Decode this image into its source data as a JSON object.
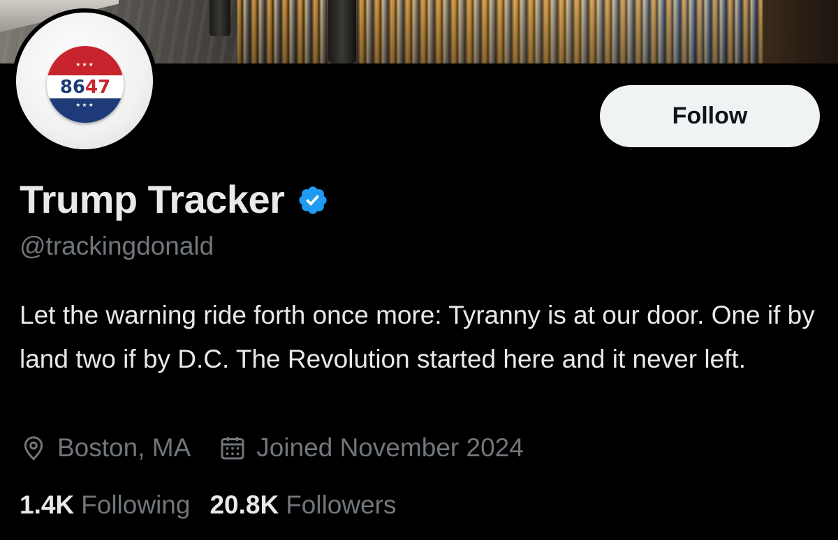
{
  "profile": {
    "display_name": "Trump Tracker",
    "handle": "@trackingdonald",
    "verified_icon": "verified-badge-icon",
    "bio": "Let the warning ride forth once more: Tyranny is at our door. One if by land two if by D.C. The Revolution started here and it never left.",
    "location": "Boston, MA",
    "joined": "Joined November 2024"
  },
  "avatar": {
    "badge_number_part1": "86",
    "badge_number_part2": "47",
    "badge_stars": "★★★"
  },
  "actions": {
    "follow_label": "Follow"
  },
  "stats": {
    "following_count": "1.4K",
    "following_label": "Following",
    "followers_count": "20.8K",
    "followers_label": "Followers"
  },
  "icons": {
    "location": "location-pin-icon",
    "calendar": "calendar-icon"
  },
  "colors": {
    "background": "#000000",
    "primary_text": "#e7e9ea",
    "secondary_text": "#71767b",
    "verified_blue": "#1d9bf0",
    "follow_button_bg": "#eff3f4",
    "badge_red": "#c8242d",
    "badge_blue": "#1f3a78"
  }
}
